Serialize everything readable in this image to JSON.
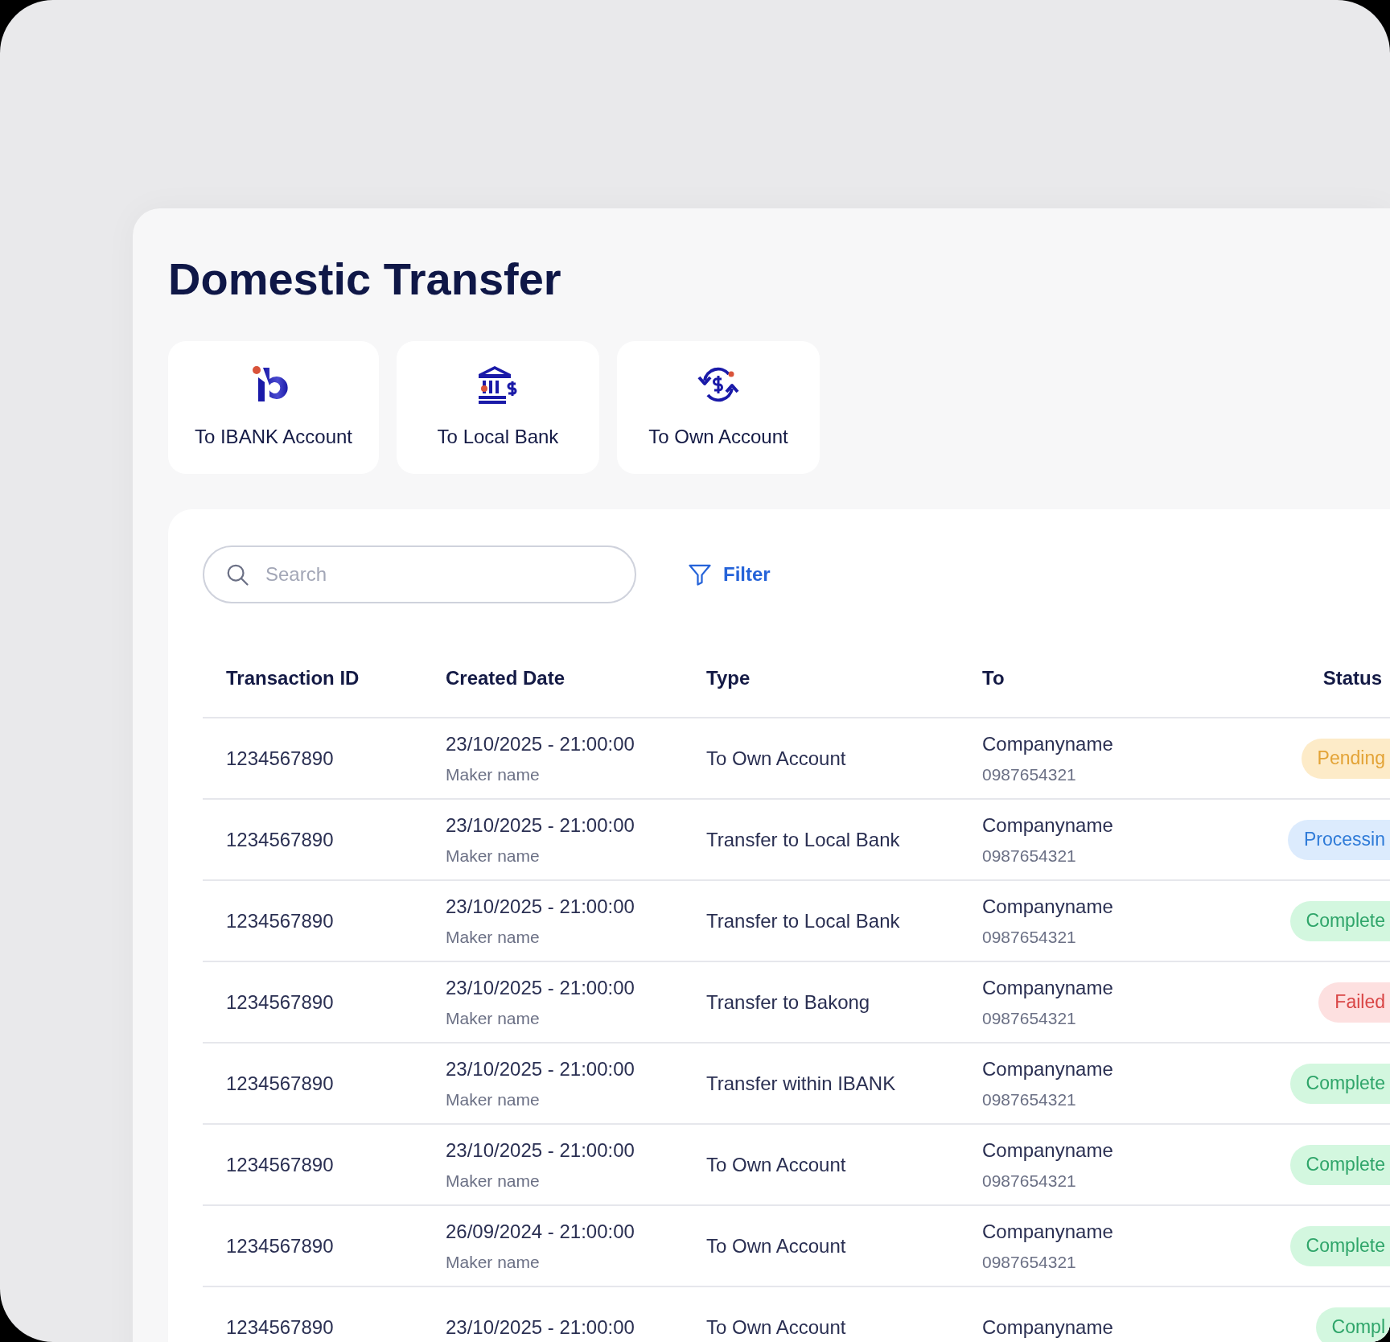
{
  "title": "Domestic Transfer",
  "transfer_options": [
    {
      "kind": "ibank",
      "label": "To IBANK Account"
    },
    {
      "kind": "local",
      "label": "To Local Bank"
    },
    {
      "kind": "own",
      "label": "To Own Account"
    }
  ],
  "search": {
    "placeholder": "Search"
  },
  "filter_button": "Filter",
  "table": {
    "columns": [
      "Transaction ID",
      "Created Date",
      "Type",
      "To",
      "Status"
    ],
    "rows": [
      {
        "id": "1234567890",
        "date": "23/10/2025 - 21:00:00",
        "maker": "Maker name",
        "type": "To Own Account",
        "to_name": "Companyname",
        "to_account": "0987654321",
        "status": "Pending",
        "kind": "pending"
      },
      {
        "id": "1234567890",
        "date": "23/10/2025 - 21:00:00",
        "maker": "Maker name",
        "type": "Transfer to Local Bank",
        "to_name": "Companyname",
        "to_account": "0987654321",
        "status": "Processin",
        "kind": "processing"
      },
      {
        "id": "1234567890",
        "date": "23/10/2025 - 21:00:00",
        "maker": "Maker name",
        "type": "Transfer to Local Bank",
        "to_name": "Companyname",
        "to_account": "0987654321",
        "status": "Complete",
        "kind": "completed"
      },
      {
        "id": "1234567890",
        "date": "23/10/2025 - 21:00:00",
        "maker": "Maker name",
        "type": "Transfer to Bakong",
        "to_name": "Companyname",
        "to_account": "0987654321",
        "status": "Failed",
        "kind": "failed"
      },
      {
        "id": "1234567890",
        "date": "23/10/2025 - 21:00:00",
        "maker": "Maker name",
        "type": "Transfer within IBANK",
        "to_name": "Companyname",
        "to_account": "0987654321",
        "status": "Complete",
        "kind": "completed"
      },
      {
        "id": "1234567890",
        "date": "23/10/2025 - 21:00:00",
        "maker": "Maker name",
        "type": "To Own Account",
        "to_name": "Companyname",
        "to_account": "0987654321",
        "status": "Complete",
        "kind": "completed"
      },
      {
        "id": "1234567890",
        "date": "26/09/2024 - 21:00:00",
        "maker": "Maker name",
        "type": "To Own Account",
        "to_name": "Companyname",
        "to_account": "0987654321",
        "status": "Complete",
        "kind": "completed"
      },
      {
        "id": "1234567890",
        "date": "23/10/2025 - 21:00:00",
        "type": "To Own Account",
        "to_name": "Companyname",
        "status": "Compl",
        "kind": "completed"
      }
    ]
  }
}
